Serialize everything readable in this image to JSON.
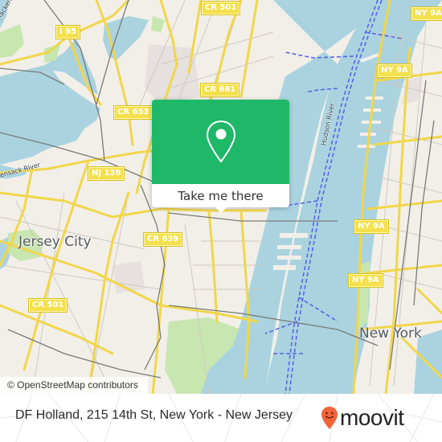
{
  "map": {
    "colors": {
      "land": "#f2efe9",
      "water": "#aad3df",
      "park": "#c8e6b0",
      "industrial": "#e6e0df",
      "major_road": "#f7e05a",
      "minor_road": "#c9c4bc",
      "rail": "#7a7a7a",
      "ferry": "#5b63e8"
    },
    "road_labels": [
      {
        "id": "i95",
        "text": "I 95"
      },
      {
        "id": "cr501-top",
        "text": "CR 501"
      },
      {
        "id": "cr681",
        "text": "CR 681"
      },
      {
        "id": "cr653",
        "text": "CR 653"
      },
      {
        "id": "nj139",
        "text": "NJ 139"
      },
      {
        "id": "cr639",
        "text": "CR 639"
      },
      {
        "id": "cr501-bottom",
        "text": "CR 501"
      },
      {
        "id": "ny9a-1",
        "text": "NY 9A"
      },
      {
        "id": "ny9a-2",
        "text": "NY 9A"
      },
      {
        "id": "ny9a-3",
        "text": "NY 9A"
      },
      {
        "id": "ny9a-4",
        "text": "NY 9A"
      }
    ],
    "place_labels": {
      "jersey_city": "Jersey City",
      "new_york": "New York"
    },
    "water_labels": {
      "hudson": "Hudson River",
      "hackensack_top": "Hackensack",
      "hackensack_mid": "Hackensack River"
    },
    "attribution": "© OpenStreetMap contributors"
  },
  "popup": {
    "icon": "map-pin-icon",
    "cta_label": "Take me there",
    "accent": "#1eb868"
  },
  "footer": {
    "address": "DF Holland, 215 14th St, New York - New Jersey",
    "brand": "moovit",
    "brand_color": "#f2643a"
  }
}
